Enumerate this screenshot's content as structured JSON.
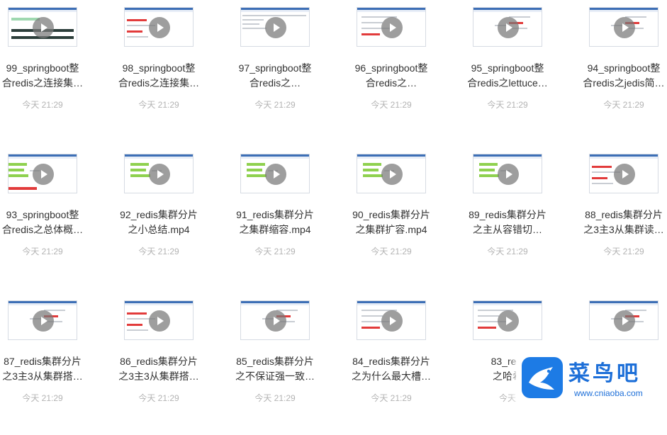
{
  "files": [
    {
      "line1": "99_springboot整",
      "line2": "合redis之连接集…",
      "time": "今天 21:29",
      "variant": "desktop"
    },
    {
      "line1": "98_springboot整",
      "line2": "合redis之连接集…",
      "time": "今天 21:29",
      "variant": "red"
    },
    {
      "line1": "97_springboot整",
      "line2": "合redis之…",
      "time": "今天 21:29",
      "variant": "ide"
    },
    {
      "line1": "96_springboot整",
      "line2": "合redis之…",
      "time": "今天 21:29",
      "variant": "text"
    },
    {
      "line1": "95_springboot整",
      "line2": "合redis之lettuce…",
      "time": "今天 21:29",
      "variant": "mind"
    },
    {
      "line1": "94_springboot整",
      "line2": "合redis之jedis简…",
      "time": "今天 21:29",
      "variant": "mind"
    },
    {
      "line1": "93_springboot整",
      "line2": "合redis之总体概…",
      "time": "今天 21:29",
      "variant": "greenleft"
    },
    {
      "line1": "92_redis集群分片",
      "line2": "之小总结.mp4",
      "time": "今天 21:29",
      "variant": "green"
    },
    {
      "line1": "91_redis集群分片",
      "line2": "之集群缩容.mp4",
      "time": "今天 21:29",
      "variant": "green"
    },
    {
      "line1": "90_redis集群分片",
      "line2": "之集群扩容.mp4",
      "time": "今天 21:29",
      "variant": "green"
    },
    {
      "line1": "89_redis集群分片",
      "line2": "之主从容错切…",
      "time": "今天 21:29",
      "variant": "green"
    },
    {
      "line1": "88_redis集群分片",
      "line2": "之3主3从集群读…",
      "time": "今天 21:29",
      "variant": "red"
    },
    {
      "line1": "87_redis集群分片",
      "line2": "之3主3从集群搭…",
      "time": "今天 21:29",
      "variant": "mind"
    },
    {
      "line1": "86_redis集群分片",
      "line2": "之3主3从集群搭…",
      "time": "今天 21:29",
      "variant": "red"
    },
    {
      "line1": "85_redis集群分片",
      "line2": "之不保证强一致…",
      "time": "今天 21:29",
      "variant": "mind"
    },
    {
      "line1": "84_redis集群分片",
      "line2": "之为什么最大槽…",
      "time": "今天 21:29",
      "variant": "text"
    },
    {
      "line1": "83_redi",
      "line2": "之哈希",
      "time": "今天",
      "variant": "text"
    },
    {
      "line1": "",
      "line2": "",
      "time": "",
      "variant": "mind"
    }
  ],
  "watermark": {
    "name": "菜鸟吧",
    "url": "www.cniaoba.com"
  }
}
